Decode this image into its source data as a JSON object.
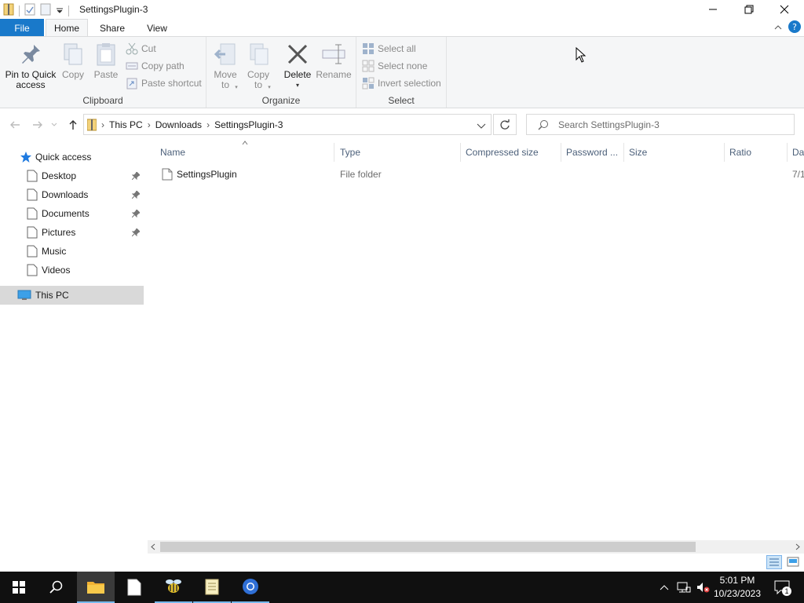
{
  "window": {
    "title": "SettingsPlugin-3"
  },
  "ribbon": {
    "tabs": {
      "file": "File",
      "home": "Home",
      "share": "Share",
      "view": "View"
    },
    "clipboard": {
      "label": "Clipboard",
      "pin": "Pin to Quick access",
      "copy": "Copy",
      "paste": "Paste",
      "cut": "Cut",
      "copy_path": "Copy path",
      "paste_shortcut": "Paste shortcut"
    },
    "organize": {
      "label": "Organize",
      "move_to": "Move to",
      "copy_to": "Copy to",
      "delete": "Delete",
      "rename": "Rename"
    },
    "select": {
      "label": "Select",
      "select_all": "Select all",
      "select_none": "Select none",
      "invert": "Invert selection"
    }
  },
  "address": {
    "crumbs": [
      "This PC",
      "Downloads",
      "SettingsPlugin-3"
    ],
    "search_placeholder": "Search SettingsPlugin-3"
  },
  "nav": {
    "quick_access": "Quick access",
    "items": [
      "Desktop",
      "Downloads",
      "Documents",
      "Pictures",
      "Music",
      "Videos"
    ],
    "this_pc": "This PC"
  },
  "columns": [
    "Name",
    "Type",
    "Compressed size",
    "Password ...",
    "Size",
    "Ratio",
    "Da"
  ],
  "files": [
    {
      "name": "SettingsPlugin",
      "type": "File folder",
      "date": "7/1"
    }
  ],
  "taskbar": {
    "time": "5:01 PM",
    "date": "10/23/2023",
    "notification_count": "1"
  },
  "colors": {
    "accent": "#1979ca",
    "taskbar": "#101010",
    "selected_nav": "#d9d9d9"
  }
}
